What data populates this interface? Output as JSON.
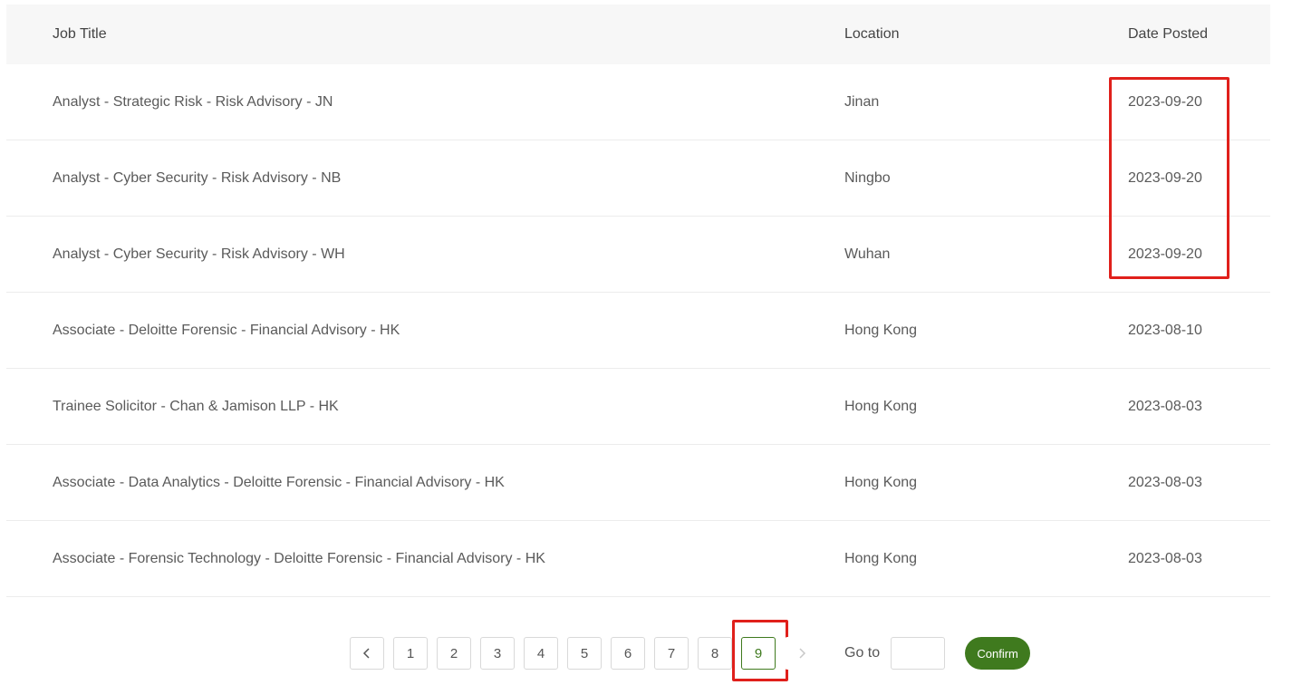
{
  "table": {
    "headers": {
      "title": "Job Title",
      "location": "Location",
      "date": "Date Posted"
    },
    "rows": [
      {
        "title": "Analyst - Strategic Risk - Risk Advisory - JN",
        "location": "Jinan",
        "date": "2023-09-20"
      },
      {
        "title": "Analyst - Cyber Security - Risk Advisory - NB",
        "location": "Ningbo",
        "date": "2023-09-20"
      },
      {
        "title": "Analyst - Cyber Security - Risk Advisory - WH",
        "location": "Wuhan",
        "date": "2023-09-20"
      },
      {
        "title": "Associate - Deloitte Forensic - Financial Advisory - HK",
        "location": "Hong Kong",
        "date": "2023-08-10"
      },
      {
        "title": "Trainee Solicitor - Chan & Jamison LLP - HK",
        "location": "Hong Kong",
        "date": "2023-08-03"
      },
      {
        "title": "Associate - Data Analytics - Deloitte Forensic - Financial Advisory - HK",
        "location": "Hong Kong",
        "date": "2023-08-03"
      },
      {
        "title": "Associate - Forensic Technology - Deloitte Forensic - Financial Advisory - HK",
        "location": "Hong Kong",
        "date": "2023-08-03"
      }
    ]
  },
  "pagination": {
    "pages": [
      "1",
      "2",
      "3",
      "4",
      "5",
      "6",
      "7",
      "8",
      "9"
    ],
    "current_page": "9",
    "prev_icon": "chevron-left-icon",
    "next_icon": "chevron-right-icon",
    "goto_label": "Go to",
    "goto_value": "",
    "confirm_label": "Confirm"
  },
  "colors": {
    "accent": "#3f7a1e",
    "highlight": "#e0201b",
    "header_bg": "#f7f7f7"
  }
}
